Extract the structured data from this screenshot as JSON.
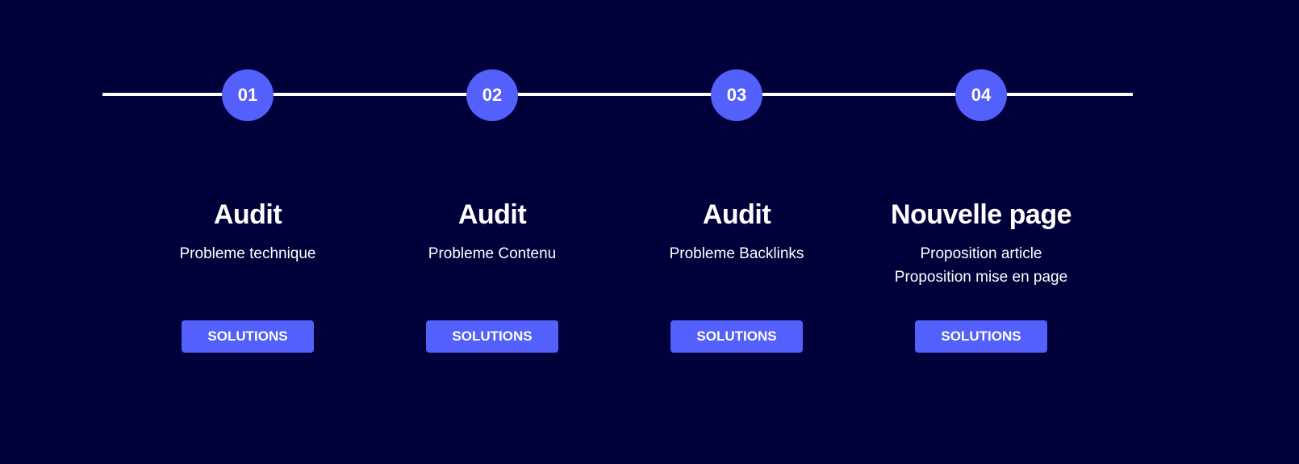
{
  "steps": [
    {
      "number": "01",
      "title": "Audit",
      "description": [
        "Probleme technique"
      ],
      "button_label": "SOLUTIONS"
    },
    {
      "number": "02",
      "title": "Audit",
      "description": [
        "Probleme Contenu"
      ],
      "button_label": "SOLUTIONS"
    },
    {
      "number": "03",
      "title": "Audit",
      "description": [
        "Probleme Backlinks"
      ],
      "button_label": "SOLUTIONS"
    },
    {
      "number": "04",
      "title": "Nouvelle page",
      "description": [
        "Proposition article",
        "Proposition mise en page"
      ],
      "button_label": "SOLUTIONS"
    }
  ],
  "colors": {
    "background": "#00003b",
    "accent": "#5460fb",
    "line": "#ffffff",
    "text": "#ffffff"
  }
}
